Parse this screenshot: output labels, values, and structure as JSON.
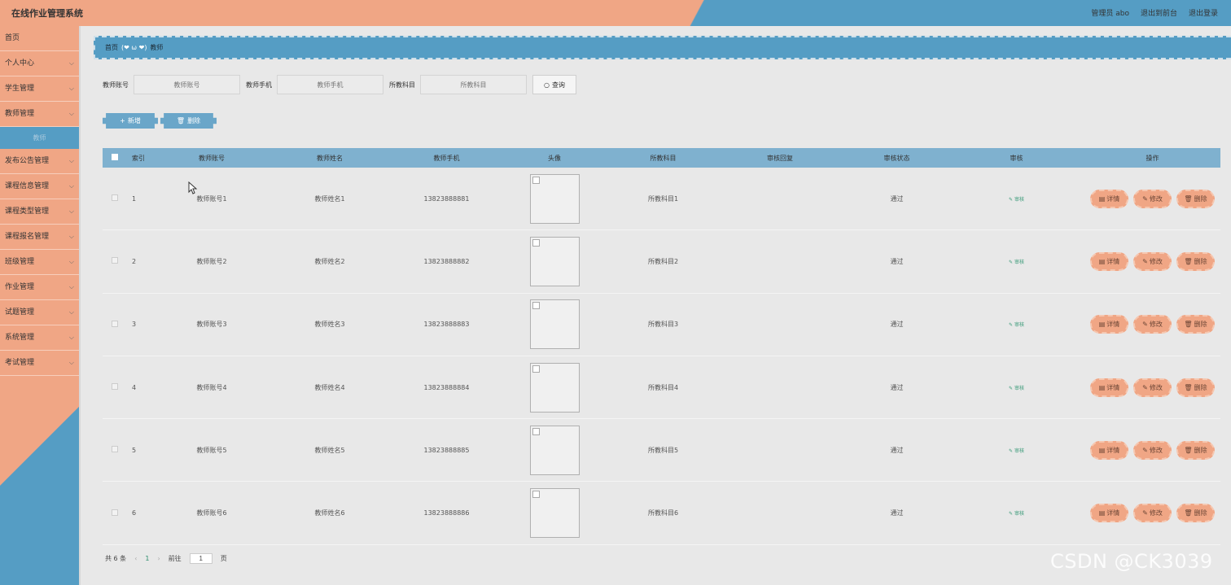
{
  "header": {
    "title": "在线作业管理系统",
    "user_label": "管理员 abo",
    "to_front_label": "退出到前台",
    "logout_label": "退出登录"
  },
  "sidebar": {
    "items": [
      {
        "label": "首页",
        "has_chevron": false
      },
      {
        "label": "个人中心",
        "has_chevron": true
      },
      {
        "label": "学生管理",
        "has_chevron": true
      },
      {
        "label": "教师管理",
        "has_chevron": true
      },
      {
        "label": "发布公告管理",
        "has_chevron": true
      },
      {
        "label": "课程信息管理",
        "has_chevron": true
      },
      {
        "label": "课程类型管理",
        "has_chevron": true
      },
      {
        "label": "课程报名管理",
        "has_chevron": true
      },
      {
        "label": "班级管理",
        "has_chevron": true
      },
      {
        "label": "作业管理",
        "has_chevron": true
      },
      {
        "label": "试题管理",
        "has_chevron": true
      },
      {
        "label": "系统管理",
        "has_chevron": true
      },
      {
        "label": "考试管理",
        "has_chevron": true
      }
    ],
    "active_sub": "教师"
  },
  "breadcrumb": {
    "home": "首页",
    "separator": "(❤ ω ❤)",
    "current": "教师"
  },
  "search": {
    "account_label": "教师账号",
    "account_placeholder": "教师账号",
    "phone_label": "教师手机",
    "phone_placeholder": "教师手机",
    "subject_label": "所教科目",
    "subject_placeholder": "所教科目",
    "query_label": "查询"
  },
  "actions": {
    "add_label": "新增",
    "delete_label": "删除"
  },
  "table": {
    "headers": {
      "index": "索引",
      "account": "教师账号",
      "name": "教师姓名",
      "phone": "教师手机",
      "avatar": "头像",
      "subject": "所教科目",
      "reply": "审核回复",
      "status": "审核状态",
      "audit": "审核",
      "ops": "操作"
    },
    "rows": [
      {
        "index": "1",
        "account": "教师账号1",
        "name": "教师姓名1",
        "phone": "13823888881",
        "subject": "所教科目1",
        "reply": "",
        "status": "通过",
        "audit": "审核"
      },
      {
        "index": "2",
        "account": "教师账号2",
        "name": "教师姓名2",
        "phone": "13823888882",
        "subject": "所教科目2",
        "reply": "",
        "status": "通过",
        "audit": "审核"
      },
      {
        "index": "3",
        "account": "教师账号3",
        "name": "教师姓名3",
        "phone": "13823888883",
        "subject": "所教科目3",
        "reply": "",
        "status": "通过",
        "audit": "审核"
      },
      {
        "index": "4",
        "account": "教师账号4",
        "name": "教师姓名4",
        "phone": "13823888884",
        "subject": "所教科目4",
        "reply": "",
        "status": "通过",
        "audit": "审核"
      },
      {
        "index": "5",
        "account": "教师账号5",
        "name": "教师姓名5",
        "phone": "13823888885",
        "subject": "所教科目5",
        "reply": "",
        "status": "通过",
        "audit": "审核"
      },
      {
        "index": "6",
        "account": "教师账号6",
        "name": "教师姓名6",
        "phone": "13823888886",
        "subject": "所教科目6",
        "reply": "",
        "status": "通过",
        "audit": "审核"
      }
    ],
    "op_labels": {
      "detail": "详情",
      "edit": "修改",
      "delete": "删除"
    }
  },
  "pagination": {
    "total_text": "共 6 条",
    "current_page": "1",
    "goto_prefix": "前往",
    "goto_value": "1",
    "goto_suffix": "页"
  },
  "watermark": "CSDN @CK3039",
  "colors": {
    "salmon": "#f0a685",
    "blue": "#559dc4",
    "table_header": "#7fb1cf",
    "audit_green": "#3a9a78"
  }
}
